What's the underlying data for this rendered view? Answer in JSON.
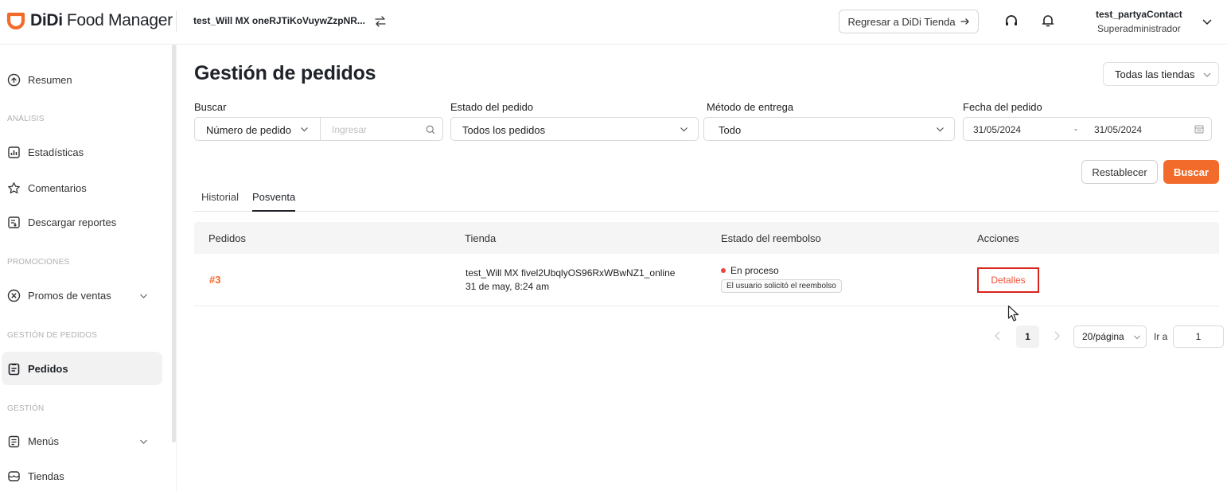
{
  "app": {
    "logo_brand": "DiDi",
    "logo_product": "Food Manager",
    "brand_color": "#f26b2b"
  },
  "header": {
    "store": "test_Will MX oneRJTiKoVuywZzpNR...",
    "back_label": "Regresar a DiDi Tienda",
    "user_name": "test_partyaContact",
    "user_role": "Superadministrador"
  },
  "sidebar": {
    "items": [
      {
        "label": "Resumen",
        "icon": "home-icon"
      },
      {
        "section": "ANÁLISIS"
      },
      {
        "label": "Estadísticas",
        "icon": "chart-icon"
      },
      {
        "label": "Comentarios",
        "icon": "star-icon"
      },
      {
        "label": "Descargar reportes",
        "icon": "report-icon"
      },
      {
        "section": "PROMOCIONES"
      },
      {
        "label": "Promos de ventas",
        "icon": "promo-icon"
      },
      {
        "section": "GESTIÓN DE PEDIDOS"
      },
      {
        "label": "Pedidos",
        "icon": "clipboard-icon",
        "active": true
      },
      {
        "section": "GESTIÓN"
      },
      {
        "label": "Menús",
        "icon": "menu-icon"
      },
      {
        "label": "Tiendas",
        "icon": "store-icon"
      }
    ]
  },
  "main": {
    "title": "Gestión de pedidos",
    "store_selector": "Todas las tiendas",
    "filters": {
      "search_label": "Buscar",
      "search_type": "Número de pedido",
      "search_placeholder": "Ingresar",
      "status_label": "Estado del pedido",
      "status_value": "Todos los pedidos",
      "delivery_label": "Método de entrega",
      "delivery_value": "Todo",
      "date_label": "Fecha del pedido",
      "date_from": "31/05/2024",
      "date_sep": "-",
      "date_to": "31/05/2024"
    },
    "reset_label": "Restablecer",
    "search_button": "Buscar",
    "tabs": [
      {
        "label": "Historial"
      },
      {
        "label": "Posventa",
        "active": true
      }
    ],
    "table": {
      "columns": [
        "Pedidos",
        "Tienda",
        "Estado del reembolso",
        "Acciones"
      ],
      "rows": [
        {
          "order": "#3",
          "store": "test_Will MX fivel2UbqlyOS96RxWBwNZ1_online",
          "date": "31 de may, 8:24 am",
          "status": "En proceso",
          "status_tag": "El usuario solicitó el reembolso",
          "action": "Detalles"
        }
      ]
    },
    "pagination": {
      "current": "1",
      "page_size": "20/página",
      "goto_label": "Ir a",
      "goto_value": "1"
    }
  }
}
